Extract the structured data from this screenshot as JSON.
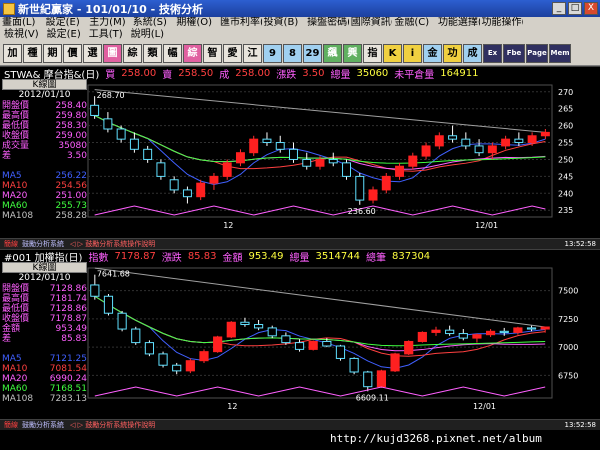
{
  "window": {
    "title": "新世紀贏家 - 101/01/10 - 技術分析",
    "min": "_",
    "max": "□",
    "close": "X"
  },
  "menu": {
    "row1": [
      "畫面(L)",
      "設定(E)",
      "主力(M)",
      "系統(S)",
      "期權(O)",
      "匯市利率(R)",
      "投資(B)",
      "操盤密碼(D)",
      "國際資訊(I)",
      "金融(C)",
      "功能選擇(A)",
      "功能操作(F)"
    ],
    "row2": [
      "檢視(V)",
      "設定(E)",
      "工具(T)",
      "說明(L)"
    ]
  },
  "toolbar": [
    "加",
    "種",
    "期",
    "價",
    "選",
    "圖",
    "綜",
    "類",
    "幅",
    "綜",
    "智",
    "愛",
    "江",
    "9",
    "8",
    "29",
    "飆",
    "興",
    "指",
    "K",
    "i",
    "金",
    "功",
    "成",
    "Ex",
    "Fbe",
    "Page",
    "Mem"
  ],
  "panels": [
    {
      "header": {
        "code": "STWA& 摩台指&(日)",
        "buy_l": "買",
        "buy": "258.00",
        "sell_l": "賣",
        "sell": "258.50",
        "deal_l": "成",
        "deal": "258.00",
        "chg_l": "漲跌",
        "chg": "3.50",
        "vol_l": "總量",
        "vol": "35060",
        "oi_l": "未平倉量",
        "oi": "164911"
      },
      "info": {
        "title": "K線圖",
        "date": "2012/01/10",
        "rows": [
          {
            "label": "開盤價",
            "value": "258.40",
            "color": "#ff60ff"
          },
          {
            "label": "最高價",
            "value": "259.80",
            "color": "#ff60ff"
          },
          {
            "label": "最低價",
            "value": "258.30",
            "color": "#ff60ff"
          },
          {
            "label": "收盤價",
            "value": "259.00",
            "color": "#ff60ff"
          },
          {
            "label": "成交量",
            "value": "35080",
            "color": "#ff60ff"
          },
          {
            "label": "差",
            "value": "3.50",
            "color": "#ff60ff"
          },
          {
            "label": "",
            "value": "",
            "color": "#fff"
          },
          {
            "label": "MA5",
            "value": "256.22",
            "color": "#4060ff"
          },
          {
            "label": "MA10",
            "value": "254.56",
            "color": "#ff4040"
          },
          {
            "label": "MA20",
            "value": "251.00",
            "color": "#ff60ff"
          },
          {
            "label": "MA60",
            "value": "255.73",
            "color": "#40ff40"
          },
          {
            "label": "MA108",
            "value": "258.28",
            "color": "#c0c0c0"
          }
        ]
      },
      "status": {
        "a": "簡線",
        "b": "鼓勵分析系統",
        "c": "◁ ▷ 鼓勵分析系統操作說明",
        "time": "13:52:58"
      },
      "chart_data": {
        "type": "candlestick",
        "y_ticks": [
          270,
          265,
          260,
          255,
          250,
          245,
          240,
          235
        ],
        "ylim": [
          233,
          272
        ],
        "x_labels": [
          "12",
          "12/01"
        ],
        "hi_label": "268.70",
        "lo_label": "236.60",
        "candles": [
          [
            266,
            268.7,
            262,
            263
          ],
          [
            262,
            264,
            258,
            259
          ],
          [
            259,
            260,
            255,
            256
          ],
          [
            256,
            258,
            252,
            253
          ],
          [
            253,
            254,
            249,
            250
          ],
          [
            249,
            250,
            244,
            245
          ],
          [
            244,
            245,
            240,
            241
          ],
          [
            241,
            242,
            237,
            239
          ],
          [
            239,
            244,
            238,
            243
          ],
          [
            243,
            246,
            241,
            245
          ],
          [
            245,
            250,
            244,
            249
          ],
          [
            249,
            253,
            248,
            252
          ],
          [
            252,
            257,
            251,
            256
          ],
          [
            256,
            258,
            254,
            255
          ],
          [
            255,
            257,
            252,
            253
          ],
          [
            253,
            255,
            249,
            250
          ],
          [
            250,
            252,
            247,
            248
          ],
          [
            248,
            251,
            247,
            250
          ],
          [
            250,
            252,
            248,
            249
          ],
          [
            249,
            250,
            244,
            245
          ],
          [
            245,
            246,
            236.6,
            238
          ],
          [
            238,
            242,
            237,
            241
          ],
          [
            241,
            246,
            240,
            245
          ],
          [
            245,
            249,
            244,
            248
          ],
          [
            248,
            252,
            247,
            251
          ],
          [
            251,
            255,
            250,
            254
          ],
          [
            254,
            258,
            253,
            257
          ],
          [
            257,
            260,
            255,
            256
          ],
          [
            256,
            258,
            253,
            254
          ],
          [
            254,
            256,
            251,
            252
          ],
          [
            252,
            255,
            250,
            254
          ],
          [
            254,
            257,
            253,
            256
          ],
          [
            256,
            258,
            254,
            255
          ],
          [
            255,
            258,
            254,
            257
          ],
          [
            257,
            259,
            256,
            258
          ]
        ]
      }
    },
    {
      "header": {
        "code": "#001 加權指(日)",
        "idx_l": "指數",
        "idx": "7178.87",
        "chg_l": "漲跌",
        "chg": "85.83",
        "amt_l": "金額",
        "amt": "953.49",
        "vol_l": "總量",
        "vol": "3514744",
        "cnt_l": "總筆",
        "cnt": "837304"
      },
      "info": {
        "title": "K線圖",
        "date": "2012/01/10",
        "rows": [
          {
            "label": "開盤價",
            "value": "7128.86",
            "color": "#ff60ff"
          },
          {
            "label": "最高價",
            "value": "7181.74",
            "color": "#ff60ff"
          },
          {
            "label": "最低價",
            "value": "7128.86",
            "color": "#ff60ff"
          },
          {
            "label": "收盤價",
            "value": "7178.87",
            "color": "#ff60ff"
          },
          {
            "label": "金額",
            "value": "953.49",
            "color": "#ff60ff"
          },
          {
            "label": "差",
            "value": "85.83",
            "color": "#ff60ff"
          },
          {
            "label": "",
            "value": "",
            "color": "#fff"
          },
          {
            "label": "MA5",
            "value": "7121.25",
            "color": "#4060ff"
          },
          {
            "label": "MA10",
            "value": "7081.54",
            "color": "#ff4040"
          },
          {
            "label": "MA20",
            "value": "6990.24",
            "color": "#ff60ff"
          },
          {
            "label": "MA60",
            "value": "7168.51",
            "color": "#40ff40"
          },
          {
            "label": "MA108",
            "value": "7283.13",
            "color": "#c0c0c0"
          }
        ]
      },
      "status": {
        "a": "簡線",
        "b": "鼓勵分析系統",
        "c": "◁ ▷ 鼓勵分析系統操作說明",
        "time": "13:52:58"
      },
      "chart_data": {
        "type": "candlestick",
        "y_ticks": [
          7500,
          7250,
          7000,
          6750
        ],
        "ylim": [
          6550,
          7700
        ],
        "x_labels": [
          "12",
          "12/01"
        ],
        "hi_label": "7641.68",
        "lo_label": "6609.11",
        "candles": [
          [
            7550,
            7641,
            7420,
            7450
          ],
          [
            7450,
            7470,
            7280,
            7300
          ],
          [
            7300,
            7320,
            7140,
            7160
          ],
          [
            7160,
            7180,
            7020,
            7040
          ],
          [
            7040,
            7060,
            6920,
            6940
          ],
          [
            6940,
            6960,
            6820,
            6840
          ],
          [
            6840,
            6860,
            6760,
            6790
          ],
          [
            6790,
            6900,
            6770,
            6880
          ],
          [
            6880,
            6980,
            6860,
            6960
          ],
          [
            6960,
            7100,
            6950,
            7090
          ],
          [
            7090,
            7230,
            7080,
            7220
          ],
          [
            7220,
            7260,
            7180,
            7200
          ],
          [
            7200,
            7240,
            7150,
            7170
          ],
          [
            7170,
            7190,
            7080,
            7100
          ],
          [
            7100,
            7130,
            7020,
            7040
          ],
          [
            7040,
            7070,
            6960,
            6980
          ],
          [
            6980,
            7060,
            6970,
            7050
          ],
          [
            7050,
            7080,
            7000,
            7010
          ],
          [
            7010,
            7020,
            6880,
            6900
          ],
          [
            6900,
            6910,
            6760,
            6780
          ],
          [
            6780,
            6790,
            6609,
            6650
          ],
          [
            6650,
            6800,
            6640,
            6790
          ],
          [
            6790,
            6950,
            6780,
            6940
          ],
          [
            6940,
            7060,
            6930,
            7050
          ],
          [
            7050,
            7140,
            7040,
            7130
          ],
          [
            7130,
            7180,
            7100,
            7150
          ],
          [
            7150,
            7190,
            7100,
            7120
          ],
          [
            7120,
            7160,
            7060,
            7080
          ],
          [
            7080,
            7120,
            7040,
            7110
          ],
          [
            7110,
            7160,
            7090,
            7140
          ],
          [
            7140,
            7170,
            7100,
            7130
          ],
          [
            7130,
            7180,
            7110,
            7170
          ],
          [
            7170,
            7190,
            7140,
            7160
          ],
          [
            7160,
            7182,
            7128,
            7178
          ]
        ]
      }
    }
  ],
  "watermark": "http://kujd3268.pixnet.net/album"
}
